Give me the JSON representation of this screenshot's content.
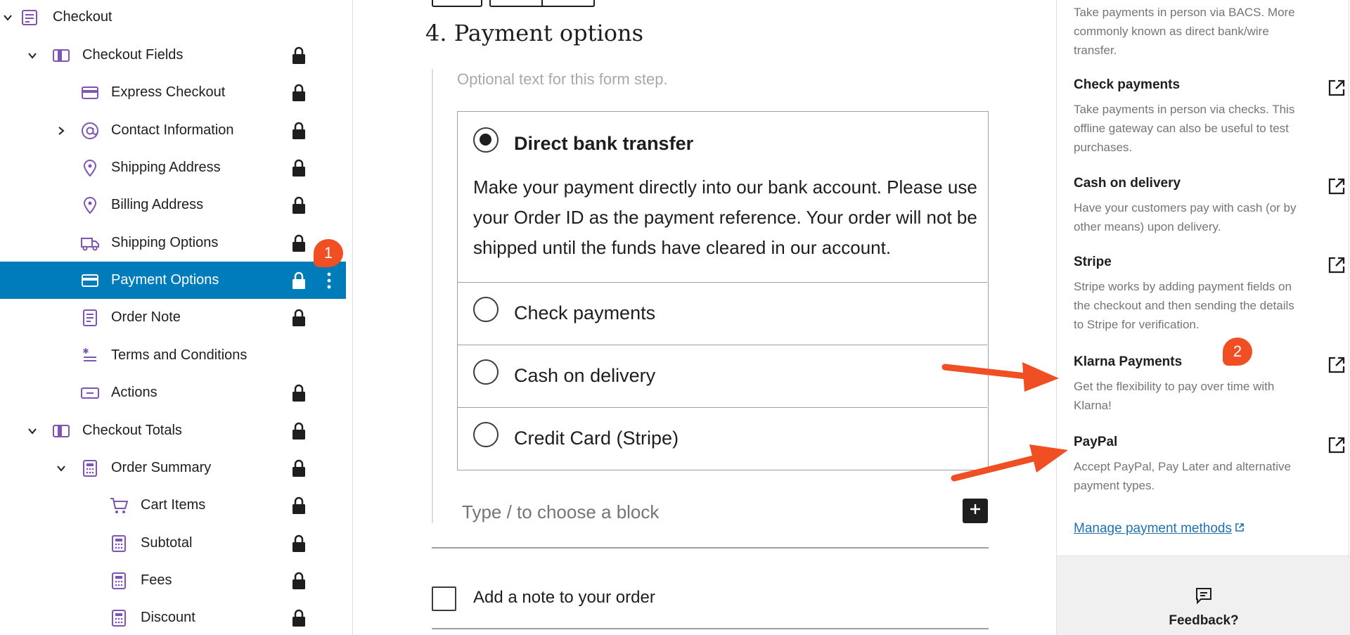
{
  "list_view": {
    "items": [
      {
        "label": "Checkout",
        "icon": "checkout-block-icon",
        "caret": "down"
      },
      {
        "label": "Checkout Fields",
        "icon": "columns-icon",
        "caret": "down",
        "locked": true
      },
      {
        "label": "Express Checkout",
        "icon": "card-icon",
        "locked": true
      },
      {
        "label": "Contact Information",
        "icon": "at-icon",
        "caret": "right",
        "locked": true
      },
      {
        "label": "Shipping Address",
        "icon": "map-pin-icon",
        "locked": true
      },
      {
        "label": "Billing Address",
        "icon": "map-pin-icon",
        "locked": true
      },
      {
        "label": "Shipping Options",
        "icon": "truck-icon",
        "locked": true
      },
      {
        "label": "Payment Options",
        "icon": "card-icon",
        "locked": true,
        "selected": true
      },
      {
        "label": "Order Note",
        "icon": "document-icon",
        "locked": true
      },
      {
        "label": "Terms and Conditions",
        "icon": "asterisk-lines-icon"
      },
      {
        "label": "Actions",
        "icon": "button-icon",
        "locked": true
      },
      {
        "label": "Checkout Totals",
        "icon": "columns-icon",
        "caret": "down",
        "locked": true
      },
      {
        "label": "Order Summary",
        "icon": "calculator-icon",
        "caret": "down",
        "locked": true
      },
      {
        "label": "Cart Items",
        "icon": "cart-icon",
        "locked": true
      },
      {
        "label": "Subtotal",
        "icon": "calculator-icon",
        "locked": true
      },
      {
        "label": "Fees",
        "icon": "calculator-icon",
        "locked": true
      },
      {
        "label": "Discount",
        "icon": "calculator-icon",
        "locked": true
      }
    ]
  },
  "editor": {
    "step_title": "4.  Payment options",
    "step_description": "Optional text for this form step.",
    "payment_methods": [
      {
        "label": "Direct bank transfer",
        "selected": true,
        "description": "Make your payment directly into our bank account. Please use your Order ID as the payment reference. Your order will not be shipped until the funds have cleared in our account."
      },
      {
        "label": "Check payments",
        "selected": false
      },
      {
        "label": "Cash on delivery",
        "selected": false
      },
      {
        "label": "Credit Card (Stripe)",
        "selected": false
      }
    ],
    "block_placeholder": "Type / to choose a block",
    "order_note_label": "Add a note to your order"
  },
  "sidebar": {
    "top_description": "Take payments in person via BACS. More commonly known as direct bank/wire transfer.",
    "gateways": [
      {
        "name": "Check payments",
        "description": "Take payments in person via checks. This offline gateway can also be useful to test purchases."
      },
      {
        "name": "Cash on delivery",
        "description": "Have your customers pay with cash (or by other means) upon delivery."
      },
      {
        "name": "Stripe",
        "description": "Stripe works by adding payment fields on the checkout and then sending the details to Stripe for verification."
      },
      {
        "name": "Klarna Payments",
        "description": "Get the flexibility to pay over time with Klarna!"
      },
      {
        "name": "PayPal",
        "description": "Accept PayPal, Pay Later and alternative payment types."
      }
    ],
    "manage_link": "Manage payment methods",
    "feedback_label": "Feedback?"
  },
  "annotations": {
    "badge_1": "1",
    "badge_2": "2"
  },
  "colors": {
    "accent": "#007cba",
    "icon_purple": "#7f54b3",
    "annotation": "#f04e23",
    "link": "#2271b1"
  }
}
